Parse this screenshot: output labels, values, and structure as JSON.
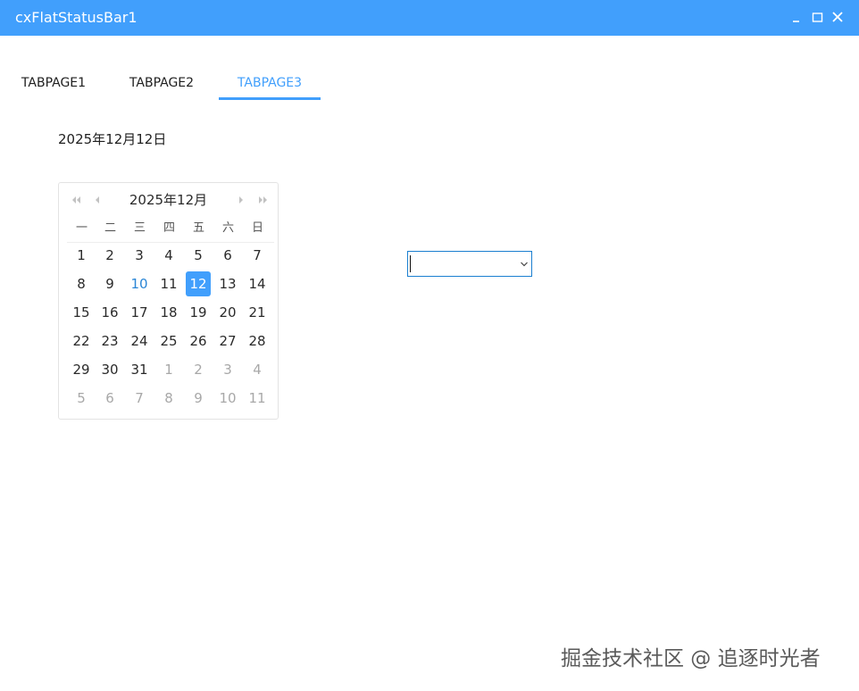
{
  "window": {
    "title": "cxFlatStatusBar1",
    "accent_color": "#419ffc"
  },
  "tabs": [
    {
      "label": "TABPAGE1",
      "active": false
    },
    {
      "label": "TABPAGE2",
      "active": false
    },
    {
      "label": "TABPAGE3",
      "active": true
    }
  ],
  "date_label": "2025年12月12日",
  "calendar": {
    "title": "2025年12月",
    "weekdays": [
      "一",
      "二",
      "三",
      "四",
      "五",
      "六",
      "日"
    ],
    "weeks": [
      [
        "1",
        "2",
        "3",
        "4",
        "5",
        "6",
        "7"
      ],
      [
        "8",
        "9",
        "10",
        "11",
        "12",
        "13",
        "14"
      ],
      [
        "15",
        "16",
        "17",
        "18",
        "19",
        "20",
        "21"
      ],
      [
        "22",
        "23",
        "24",
        "25",
        "26",
        "27",
        "28"
      ],
      [
        "29",
        "30",
        "31",
        "1",
        "2",
        "3",
        "4"
      ],
      [
        "5",
        "6",
        "7",
        "8",
        "9",
        "10",
        "11"
      ]
    ],
    "today": "10",
    "selected": "12",
    "nav_icons": [
      "double-chevron-left-icon",
      "chevron-left-icon",
      "chevron-right-icon",
      "double-chevron-right-icon"
    ]
  },
  "combo": {
    "value": "",
    "icon": "chevron-down-icon",
    "border_color": "#1b7fd0"
  },
  "watermark": {
    "text": "掘金技术社区 @ 追逐时光者"
  }
}
